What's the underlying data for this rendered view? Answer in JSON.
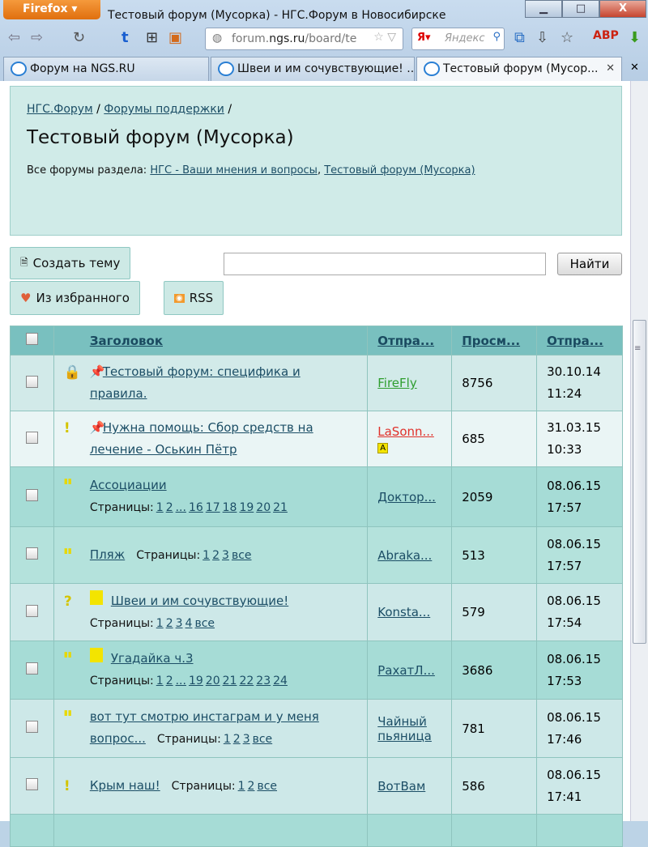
{
  "browser": {
    "menu_label": "Firefox",
    "window_title": "Тестовый форум (Мусорка) - НГС.Форум в Новосибирске",
    "url_prefix": "forum.",
    "url_domain": "ngs.ru",
    "url_path": "/board/te",
    "search_placeholder": "Яндекс",
    "tabs": [
      {
        "label": "Форум на NGS.RU"
      },
      {
        "label": "Швеи и им сочувствующие! ..."
      },
      {
        "label": "Тестовый форум (Мусор..."
      }
    ]
  },
  "header": {
    "breadcrumbs": [
      "НГС.Форум",
      "Форумы поддержки"
    ],
    "title": "Тестовый форум (Мусорка)",
    "all_forums_label": "Все форумы раздела:",
    "all_forums": [
      "НГС - Ваши мнения и вопросы",
      "Тестовый форум (Мусорка)"
    ]
  },
  "toolbar": {
    "create_topic": "Создать тему",
    "favorites": "Из избранного",
    "rss": "RSS",
    "search_button": "Найти",
    "search_value": ""
  },
  "table": {
    "columns": [
      "Заголовок",
      "Отпра...",
      "Просм...",
      "Отпра..."
    ],
    "pages_label": "Страницы:",
    "rows": [
      {
        "status": "lock",
        "pinned": true,
        "title": "Тестовый форум: специфика и правила.",
        "pages": [],
        "author": "FireFly",
        "author_color": "#2f9e2f",
        "views": "8756",
        "date": "30.10.14",
        "time": "11:24",
        "bg": "#d2eae9"
      },
      {
        "status": "important",
        "pinned": true,
        "title": "Нужна помощь: Сбор средств на лечение - Оськин Пётр",
        "pages": [],
        "author": "LaSonn...",
        "author_color": "#e0302a",
        "views": "685",
        "date": "31.03.15",
        "time": "10:33",
        "bg": "#eaf5f5"
      },
      {
        "status": "book",
        "title": "Ассоциации",
        "pages": [
          "1",
          "2",
          "...",
          "16",
          "17",
          "18",
          "19",
          "20",
          "21"
        ],
        "author": "Доктор...",
        "views": "2059",
        "date": "08.06.15",
        "time": "17:57",
        "bg": "#a6dcd6"
      },
      {
        "status": "book",
        "title": "Пляж",
        "pages": [
          "1",
          "2",
          "3",
          "все"
        ],
        "inline": true,
        "author": "Abraka...",
        "views": "513",
        "date": "08.06.15",
        "time": "17:57",
        "bg": "#b4e2dc"
      },
      {
        "status": "question",
        "floppy": true,
        "title": "Швеи и им сочувствующие!",
        "pages": [
          "1",
          "2",
          "3",
          "4",
          "все"
        ],
        "author": "Konsta...",
        "views": "579",
        "date": "08.06.15",
        "time": "17:54",
        "bg": "#cde8e8"
      },
      {
        "status": "book",
        "floppy": true,
        "title": "Угадайка ч.3",
        "pages": [
          "1",
          "2",
          "...",
          "19",
          "20",
          "21",
          "22",
          "23",
          "24"
        ],
        "author": "РахатЛ...",
        "views": "3686",
        "date": "08.06.15",
        "time": "17:53",
        "bg": "#a6dcd6"
      },
      {
        "status": "book",
        "title": "вот тут смотрю инстаграм и у меня вопрос...",
        "pages": [
          "1",
          "2",
          "3",
          "все"
        ],
        "inline": true,
        "author": "Чайный пьяница",
        "views": "781",
        "date": "08.06.15",
        "time": "17:46",
        "bg": "#cde8e8"
      },
      {
        "status": "important",
        "title": "Крым наш!",
        "pages": [
          "1",
          "2",
          "все"
        ],
        "inline": true,
        "author": "ВотВам",
        "views": "586",
        "date": "08.06.15",
        "time": "17:41",
        "bg": "#cde8e8"
      }
    ]
  }
}
